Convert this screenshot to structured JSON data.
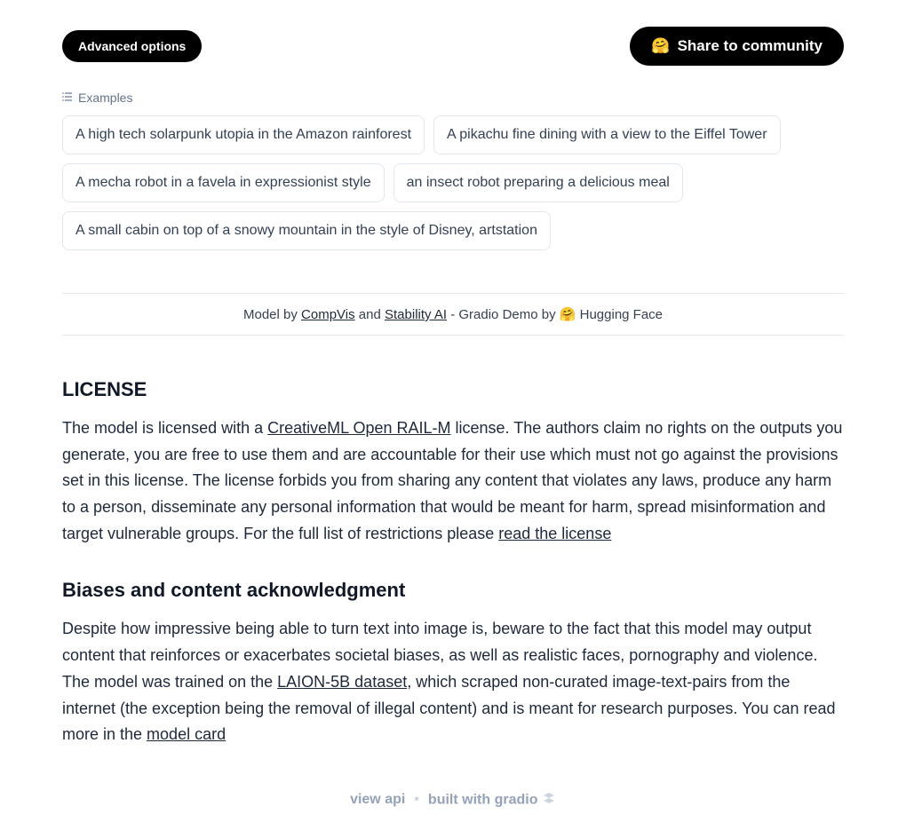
{
  "buttons": {
    "advanced": "Advanced options",
    "share": "Share to community",
    "share_emoji": "🤗"
  },
  "examples": {
    "label": "Examples",
    "items": [
      "A high tech solarpunk utopia in the Amazon rainforest",
      "A pikachu fine dining with a view to the Eiffel Tower",
      "A mecha robot in a favela in expressionist style",
      "an insect robot preparing a delicious meal",
      "A small cabin on top of a snowy mountain in the style of Disney, artstation"
    ]
  },
  "credits": {
    "prefix": "Model by ",
    "compvis": "CompVis",
    "and": " and ",
    "stability": "Stability AI",
    "middle": " - Gradio Demo by ",
    "hf_emoji": "🤗",
    "hf": " Hugging Face"
  },
  "license": {
    "title": "LICENSE",
    "text_1": "The model is licensed with a ",
    "link_1": "CreativeML Open RAIL-M",
    "text_2": " license. The authors claim no rights on the outputs you generate, you are free to use them and are accountable for their use which must not go against the provisions set in this license. The license forbids you from sharing any content that violates any laws, produce any harm to a person, disseminate any personal information that would be meant for harm, spread misinformation and target vulnerable groups. For the full list of restrictions please ",
    "link_2": "read the license"
  },
  "biases": {
    "title": "Biases and content acknowledgment",
    "text_1": "Despite how impressive being able to turn text into image is, beware to the fact that this model may output content that reinforces or exacerbates societal biases, as well as realistic faces, pornography and violence. The model was trained on the ",
    "link_1": "LAION-5B dataset",
    "text_2": ", which scraped non-curated image-text-pairs from the internet (the exception being the removal of illegal content) and is meant for research purposes. You can read more in the ",
    "link_2": "model card"
  },
  "footer": {
    "view_api": "view api",
    "sep": "•",
    "built_with": "built with gradio"
  }
}
